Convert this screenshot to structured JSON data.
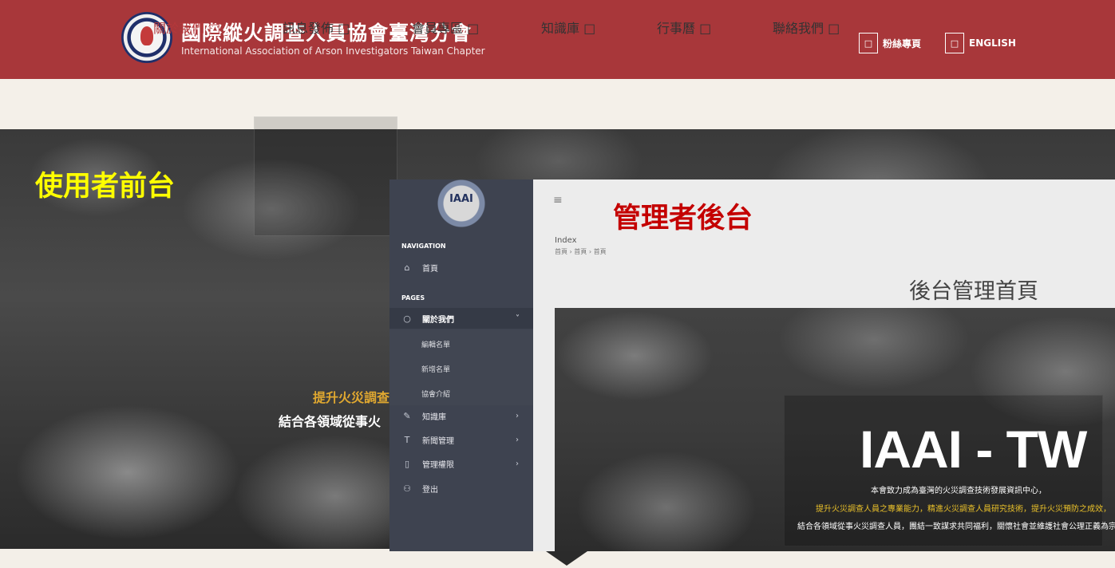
{
  "header": {
    "title_zh": "國際縱火調查人員協會臺灣分會",
    "title_en": "International Association of Arson Investigators Taiwan Chapter",
    "links": [
      {
        "icon": "□",
        "label": "粉絲專頁",
        "icon_name": "facebook-icon"
      },
      {
        "icon": "□",
        "label": "ENGLISH",
        "icon_name": "globe-icon"
      }
    ]
  },
  "nav": {
    "items": [
      {
        "label": "關於我們 □",
        "active": true
      },
      {
        "label": "訊息發佈 □",
        "active": false
      },
      {
        "label": "會員專區 □",
        "active": false
      },
      {
        "label": "知識庫 □",
        "active": false
      },
      {
        "label": "行事曆 □",
        "active": false
      },
      {
        "label": "聯絡我們 □",
        "active": false
      }
    ],
    "active_color": "#b4383b"
  },
  "hero": {
    "front_label": "使用者前台",
    "text_line1": "提升火災調查",
    "text_line2": "結合各領域從事火"
  },
  "admin": {
    "logo_text": "IAAI",
    "back_label": "管理者後台",
    "sidebar": {
      "nav_heading": "NAVIGATION",
      "home": {
        "icon": "⌂",
        "label": "首頁"
      },
      "pages_heading": "PAGES",
      "items": [
        {
          "icon": "○",
          "label": "關於我們",
          "chevron": "˅"
        },
        {
          "icon": "✎",
          "label": "知識庫",
          "chevron": "›"
        },
        {
          "icon": "T",
          "label": "新聞管理",
          "chevron": "›"
        },
        {
          "icon": "▯",
          "label": "管理權限",
          "chevron": "›"
        },
        {
          "icon": "⚇",
          "label": "登出",
          "chevron": ""
        }
      ],
      "subitems": [
        "編輯名單",
        "新增名單",
        "協會介紹"
      ]
    },
    "content": {
      "hamburger": "≡",
      "breadcrumb_title": "Index",
      "breadcrumbs": "首頁 › 首頁 › 首頁",
      "page_title": "後台管理首頁",
      "banner_title": "IAAI - TW",
      "banner_line1": "本會致力成為臺灣的火災調查技術發展資訊中心，",
      "banner_line2": "提升火災調查人員之專業能力，精進火災調查人員研究技術，提升火災預防之成效，",
      "banner_line3": "結合各領域從事火災調查人員，團結一致謀求共同福利，關懷社會並維護社會公理正義為宗旨。"
    }
  },
  "colors": {
    "header_bg": "#a8373a",
    "nav_bg": "#f4f0e9",
    "front_label": "#ffff00",
    "back_label": "#c40000",
    "sidebar_bg": "#3e4350"
  }
}
